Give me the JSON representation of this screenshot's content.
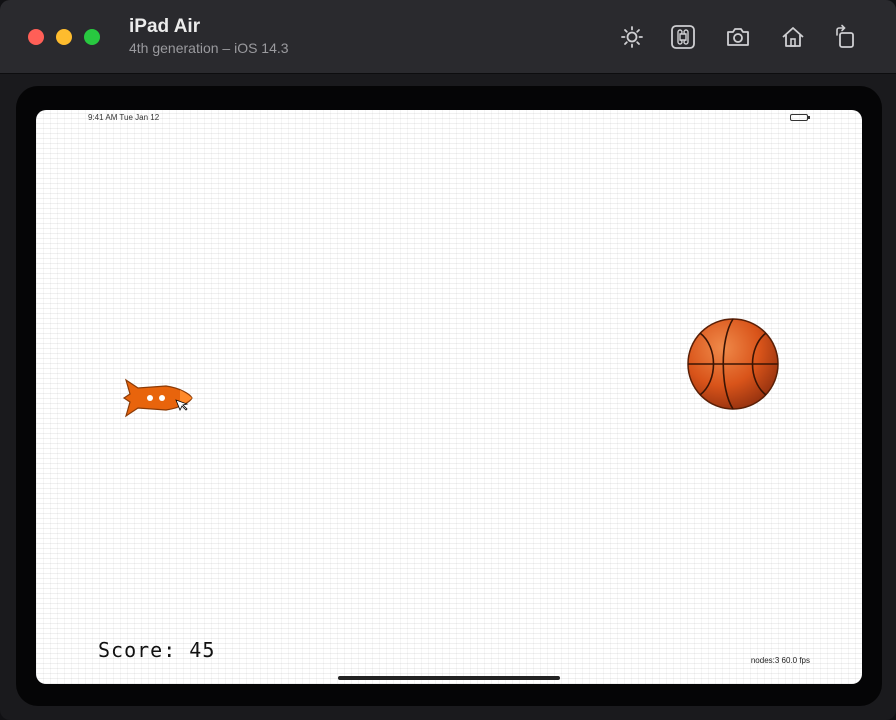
{
  "window": {
    "title": "iPad Air",
    "subtitle": "4th generation – iOS 14.3"
  },
  "toolbar": {
    "items": [
      {
        "icon": "brightness-icon"
      },
      {
        "icon": "command-icon"
      },
      {
        "icon": "screenshot-icon"
      },
      {
        "icon": "home-icon"
      },
      {
        "icon": "rotate-icon"
      }
    ]
  },
  "game": {
    "score_label": "Score: 45",
    "status_time": "9:41 AM Tue Jan 12",
    "fps_label": "nodes:3 60.0 fps"
  },
  "colors": {
    "titlebar": "#2a2a2e",
    "rocket": "#e8640c",
    "ball": "#d9541a"
  }
}
